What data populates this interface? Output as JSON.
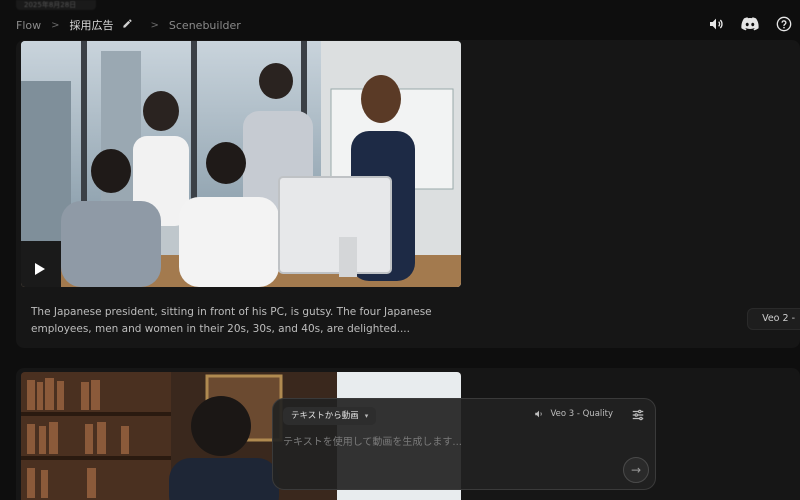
{
  "header": {
    "date_tag": "2025年8月28日",
    "breadcrumb": [
      {
        "label": "Flow"
      },
      {
        "label": "採用広告"
      },
      {
        "label": "Scenebuilder"
      }
    ],
    "icons": [
      "speaker-icon",
      "discord-icon",
      "help-icon"
    ]
  },
  "clips": [
    {
      "description": "The Japanese president, sitting in front of his PC, is gutsy. The four Japanese employees, men and women in their 20s, 30s, and 40s, are delighted....",
      "model_label": "Veo 2 -"
    }
  ],
  "composer": {
    "mode_label": "テキストから動画",
    "model_label": "Veo 3 - Quality",
    "placeholder": "テキストを使用して動画を生成します..."
  }
}
